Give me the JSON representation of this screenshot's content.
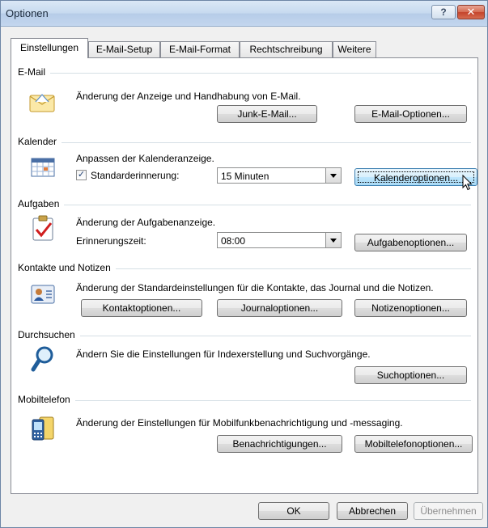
{
  "window": {
    "title": "Optionen",
    "help_label": "?",
    "close_label": "✕"
  },
  "tabs": [
    {
      "label": "Einstellungen",
      "active": true
    },
    {
      "label": "E-Mail-Setup",
      "active": false
    },
    {
      "label": "E-Mail-Format",
      "active": false
    },
    {
      "label": "Rechtschreibung",
      "active": false
    },
    {
      "label": "Weitere",
      "active": false
    }
  ],
  "email": {
    "title": "E-Mail",
    "icon": "envelope-icon",
    "description": "Änderung der Anzeige und Handhabung von E-Mail.",
    "junk_button": "Junk-E-Mail...",
    "options_button": "E-Mail-Optionen..."
  },
  "calendar": {
    "title": "Kalender",
    "icon": "calendar-icon",
    "description": "Anpassen der Kalenderanzeige.",
    "reminder_checkbox_label": "Standarderinnerung:",
    "reminder_checked": true,
    "reminder_value": "15 Minuten",
    "options_button": "Kalenderoptionen..."
  },
  "tasks": {
    "title": "Aufgaben",
    "icon": "task-clipboard-icon",
    "description": "Änderung der Aufgabenanzeige.",
    "reminder_time_label": "Erinnerungszeit:",
    "reminder_time_value": "08:00",
    "options_button": "Aufgabenoptionen..."
  },
  "contacts": {
    "title": "Kontakte und Notizen",
    "icon": "contact-card-icon",
    "description": "Änderung der Standardeinstellungen für die Kontakte, das Journal und die Notizen.",
    "contact_button": "Kontaktoptionen...",
    "journal_button": "Journaloptionen...",
    "notes_button": "Notizenoptionen..."
  },
  "search": {
    "title": "Durchsuchen",
    "icon": "magnifier-icon",
    "description": "Ändern Sie die Einstellungen für Indexerstellung und Suchvorgänge.",
    "options_button": "Suchoptionen..."
  },
  "mobile": {
    "title": "Mobiltelefon",
    "icon": "mobile-phone-icon",
    "description": "Änderung der Einstellungen für Mobilfunkbenachrichtigung und -messaging.",
    "notifications_button": "Benachrichtigungen...",
    "options_button": "Mobiltelefonoptionen..."
  },
  "footer": {
    "ok": "OK",
    "cancel": "Abbrechen",
    "apply": "Übernehmen"
  },
  "colors": {
    "accent": "#3c7fb1",
    "title_gradient_top": "#dbe8f6",
    "close_red": "#c4432b"
  }
}
